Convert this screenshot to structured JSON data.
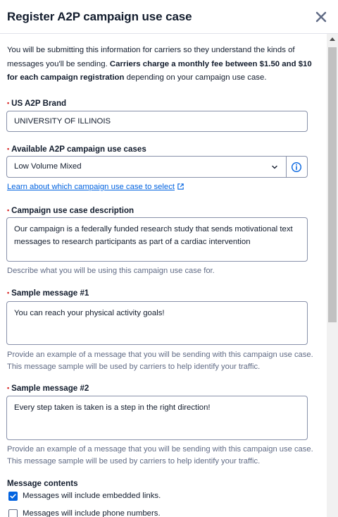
{
  "dialog": {
    "title": "Register A2P campaign use case",
    "close_label": "Close"
  },
  "intro": {
    "text_1": "You will be submitting this information for carriers so they understand the kinds of messages you'll be sending.",
    "text_bold": "Carriers charge a monthly fee between $1.50 and $10 for each campaign registration",
    "text_2": "depending on your campaign use case."
  },
  "brand": {
    "label": "US A2P Brand",
    "value": "UNIVERSITY OF ILLINOIS"
  },
  "use_case": {
    "label": "Available A2P campaign use cases",
    "selected": "Low Volume Mixed",
    "learn_link": "Learn about which campaign use case to select"
  },
  "description": {
    "label": "Campaign use case description",
    "value": "Our campaign is a federally funded research study that sends motivational text messages to research participants as part of a cardiac intervention",
    "help": "Describe what you will be using this campaign use case for."
  },
  "sample1": {
    "label": "Sample message #1",
    "value": "You can reach your physical activity goals!",
    "help": "Provide an example of a message that you will be sending with this campaign use case. This message sample will be used by carriers to help identify your traffic."
  },
  "sample2": {
    "label": "Sample message #2",
    "value": "Every step taken is taken is a step in the right direction!",
    "help": "Provide an example of a message that you will be sending with this campaign use case. This message sample will be used by carriers to help identify your traffic."
  },
  "message_contents": {
    "title": "Message contents",
    "options": [
      {
        "label": "Messages will include embedded links.",
        "checked": true
      },
      {
        "label": "Messages will include phone numbers.",
        "checked": false
      }
    ]
  },
  "colors": {
    "accent": "#0263e0",
    "required": "#d61f1f",
    "border": "#8891aa",
    "help_text": "#606b85"
  }
}
